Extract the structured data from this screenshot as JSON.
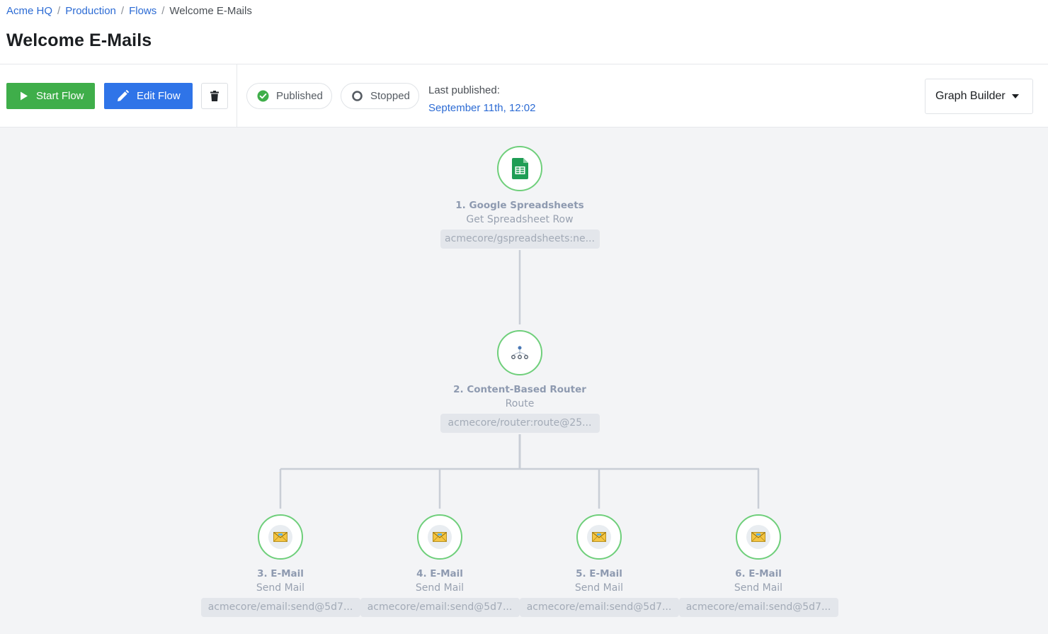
{
  "breadcrumb": {
    "items": [
      "Acme HQ",
      "Production",
      "Flows"
    ],
    "current": "Welcome E-Mails",
    "separator": "/"
  },
  "page_title": "Welcome E-Mails",
  "toolbar": {
    "start_label": "Start Flow",
    "edit_label": "Edit Flow",
    "published_label": "Published",
    "stopped_label": "Stopped",
    "last_published_label": "Last published:",
    "last_published_value": "September 11th, 12:02",
    "view_selector_label": "Graph Builder"
  },
  "colors": {
    "start_button": "#3fae4a",
    "edit_button": "#2f74e8",
    "link": "#2c6bd4",
    "node_border": "#6fcf7b",
    "canvas_bg": "#f3f4f6"
  },
  "nodes": [
    {
      "title": "1. Google Spreadsheets",
      "subtitle": "Get Spreadsheet Row",
      "tag": "acmecore/gspreadsheets:ne...",
      "icon": "google-sheets-icon"
    },
    {
      "title": "2. Content-Based Router",
      "subtitle": "Route",
      "tag": "acmecore/router:route@25...",
      "icon": "router-icon"
    },
    {
      "title": "3. E-Mail",
      "subtitle": "Send Mail",
      "tag": "acmecore/email:send@5d7...",
      "icon": "email-icon"
    },
    {
      "title": "4. E-Mail",
      "subtitle": "Send Mail",
      "tag": "acmecore/email:send@5d7...",
      "icon": "email-icon"
    },
    {
      "title": "5. E-Mail",
      "subtitle": "Send Mail",
      "tag": "acmecore/email:send@5d7...",
      "icon": "email-icon"
    },
    {
      "title": "6. E-Mail",
      "subtitle": "Send Mail",
      "tag": "acmecore/email:send@5d7...",
      "icon": "email-icon"
    }
  ]
}
